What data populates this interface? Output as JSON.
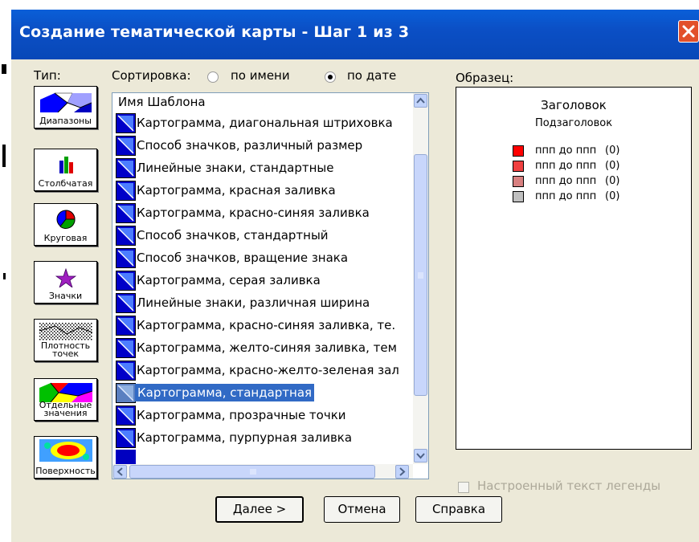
{
  "window": {
    "title": "Создание тематической карты - Шаг 1 из 3"
  },
  "type_label": "Тип:",
  "sort": {
    "label": "Сортировка:",
    "options": [
      {
        "label": "по имени",
        "selected": false
      },
      {
        "label": "по дате",
        "selected": true
      }
    ]
  },
  "types": [
    {
      "label": "Диапазоны",
      "icon": "ranges-icon",
      "selected": true
    },
    {
      "label": "Столбчатая",
      "icon": "bar-chart-icon",
      "selected": false
    },
    {
      "label": "Круговая",
      "icon": "pie-chart-icon",
      "selected": false
    },
    {
      "label": "Значки",
      "icon": "star-icon",
      "selected": false
    },
    {
      "label": "Плотность точек",
      "icon": "dot-density-icon",
      "selected": false
    },
    {
      "label": "Отдельные значения",
      "icon": "individual-values-icon",
      "selected": false
    },
    {
      "label": "Поверхность",
      "icon": "surface-icon",
      "selected": false
    }
  ],
  "templates": {
    "header": "Имя Шаблона",
    "selected_index": 12,
    "items": [
      "Картограмма, диагональная штриховка",
      "Способ значков, различный размер",
      "Линейные знаки, стандартные",
      "Картограмма, красная заливка",
      "Картограмма, красно-синяя заливка",
      "Способ значков, стандартный",
      "Способ значков, вращение знака",
      "Картограмма, серая заливка",
      "Линейные знаки, различная ширина",
      "Картограмма, красно-синяя заливка, те.",
      "Картограмма, желто-синяя заливка, тем",
      "Картограмма, красно-желто-зеленая зал",
      "Картограмма, стандартная",
      "Картограмма, прозрачные точки",
      "Картограмма, пурпурная заливка"
    ]
  },
  "sample": {
    "label": "Образец:",
    "title": "Заголовок",
    "subtitle": "Подзаголовок",
    "legend": [
      {
        "text": "ппп до ппп",
        "count": "(0)",
        "color": "#ff0000"
      },
      {
        "text": "ппп до ппп",
        "count": "(0)",
        "color": "#f04040"
      },
      {
        "text": "ппп до ппп",
        "count": "(0)",
        "color": "#d88080"
      },
      {
        "text": "ппп до ппп",
        "count": "(0)",
        "color": "#c0c0c0"
      }
    ]
  },
  "custom_legend": {
    "label": "Настроенный текст легенды",
    "checked": false,
    "enabled": false
  },
  "buttons": {
    "next": "Далее >",
    "cancel": "Отмена",
    "help": "Справка"
  },
  "colors": {
    "titlebar": "#0b4fc5",
    "selection": "#316ac5",
    "dialog_bg": "#ece9d8"
  }
}
